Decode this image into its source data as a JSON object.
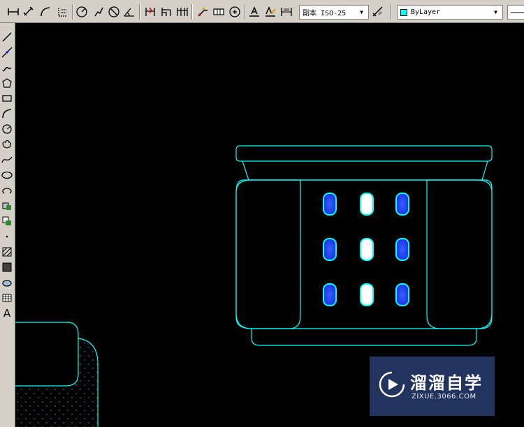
{
  "toolbar": {
    "dimstyle_value": "副本 ISO-25",
    "layer_value": "ByLayer",
    "layer_color": "#00ffff",
    "dropdown_arrow": "▼"
  },
  "left_toolbar": {
    "text_tool_label": "A"
  },
  "drawing": {
    "line_color": "#00ffff",
    "button_fill_blue": "#1a3cff",
    "button_fill_white": "#ffffff",
    "button_rows": 3,
    "button_cols": 3
  },
  "watermark": {
    "title": "溜溜自学",
    "url": "ZIXUE.3066.COM",
    "background": "#283c6e"
  }
}
